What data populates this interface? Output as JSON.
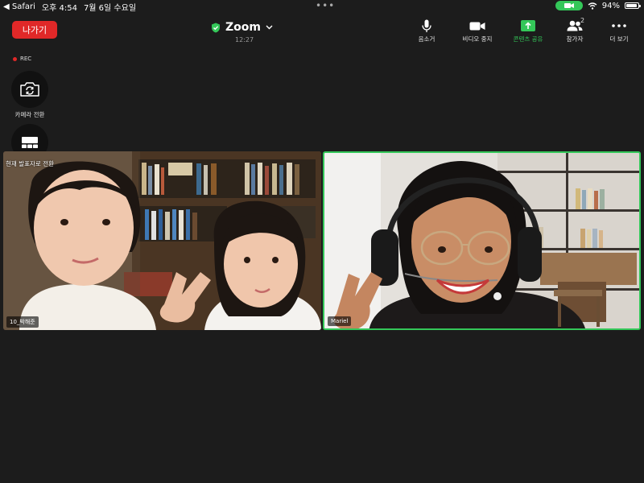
{
  "status_bar": {
    "back_app": "◀ Safari",
    "time": "오후 4:54",
    "date": "7월 6일 수요일",
    "dots": "•••",
    "battery": "94%"
  },
  "header": {
    "leave_label": "나가기",
    "meeting_title": "Zoom",
    "elapsed": "12:27"
  },
  "toolbar": {
    "items": [
      {
        "label": "음소거",
        "icon": "microphone-icon"
      },
      {
        "label": "비디오 중지",
        "icon": "video-camera-icon"
      },
      {
        "label": "콘텐츠 공유",
        "icon": "share-screen-icon"
      },
      {
        "label": "참가자",
        "icon": "participants-icon",
        "count": "2"
      },
      {
        "label": "더 보기",
        "icon": "more-icon"
      }
    ]
  },
  "recording": {
    "label": "REC"
  },
  "side_controls": {
    "switch_camera": "카메라 전환",
    "switch_view": "현재 발표자로 전환"
  },
  "participants": [
    {
      "name": "10_박해준"
    },
    {
      "name": "Mariel"
    }
  ],
  "colors": {
    "accent": "#34c759",
    "leave": "#e02828",
    "background": "#1c1c1c"
  }
}
